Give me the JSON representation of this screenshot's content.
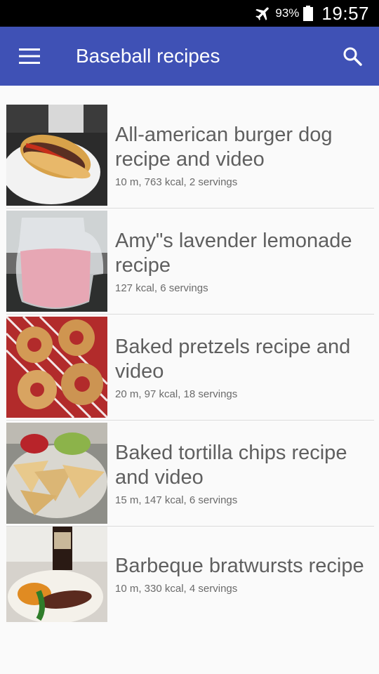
{
  "status_bar": {
    "battery_percent": "93%",
    "time": "19:57",
    "icons": [
      "airplane-mode-icon",
      "battery-icon"
    ]
  },
  "app_bar": {
    "title": "Baseball recipes",
    "menu_icon": "hamburger-menu-icon",
    "search_icon": "search-icon",
    "color": "#3f51b5"
  },
  "recipes": [
    {
      "title": "All-american burger dog recipe and video",
      "meta": "10 m, 763 kcal, 2 servings"
    },
    {
      "title": "Amy\"s lavender lemonade recipe",
      "meta": "127 kcal, 6 servings"
    },
    {
      "title": "Baked pretzels recipe and video",
      "meta": "20 m, 97 kcal, 18 servings"
    },
    {
      "title": "Baked tortilla chips recipe and video",
      "meta": "15 m, 147 kcal, 6 servings"
    },
    {
      "title": "Barbeque bratwursts recipe",
      "meta": "10 m, 330 kcal, 4 servings"
    }
  ]
}
